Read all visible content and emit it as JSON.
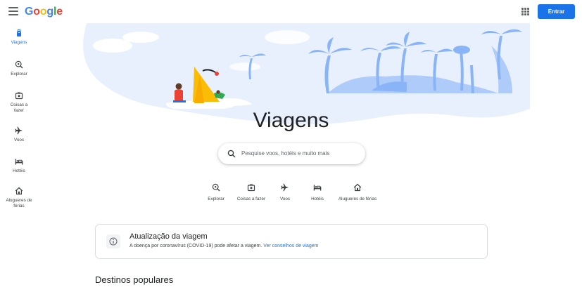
{
  "header": {
    "logo": {
      "G": "G",
      "o1": "o",
      "o2": "o",
      "g": "g",
      "l": "l",
      "e": "e"
    },
    "signin_label": "Entrar",
    "menu_icon": "hamburger-menu-icon",
    "apps_icon": "apps-grid-icon"
  },
  "sidebar": {
    "items": [
      {
        "label": "Viagens",
        "icon": "suitcase-icon",
        "active": true
      },
      {
        "label": "Explorar",
        "icon": "explore-icon",
        "active": false
      },
      {
        "label": "Coisas a fazer",
        "icon": "camera-icon",
        "active": false
      },
      {
        "label": "Voos",
        "icon": "airplane-icon",
        "active": false
      },
      {
        "label": "Hotéis",
        "icon": "bed-icon",
        "active": false
      },
      {
        "label": "Alugueres de férias",
        "icon": "house-icon",
        "active": false
      }
    ]
  },
  "main": {
    "title": "Viagens",
    "search": {
      "placeholder": "Pesquise voos, hotéis e muito mais"
    },
    "categories": [
      {
        "label": "Explorar",
        "icon": "explore-icon"
      },
      {
        "label": "Coisas a fazer",
        "icon": "camera-icon"
      },
      {
        "label": "Voos",
        "icon": "airplane-icon"
      },
      {
        "label": "Hotéis",
        "icon": "bed-icon"
      },
      {
        "label": "Alugueres de férias",
        "icon": "house-icon"
      }
    ],
    "update": {
      "title": "Atualização da viagem",
      "text": "A doença por coronavírus (COVID-19) pode afetar a viagem.",
      "link": "Ver conselhos de viagem"
    },
    "popular_title": "Destinos populares"
  },
  "colors": {
    "accent": "#1a73e8",
    "hero_blue": "#aecbfa",
    "hero_light": "#e8f0fe"
  }
}
